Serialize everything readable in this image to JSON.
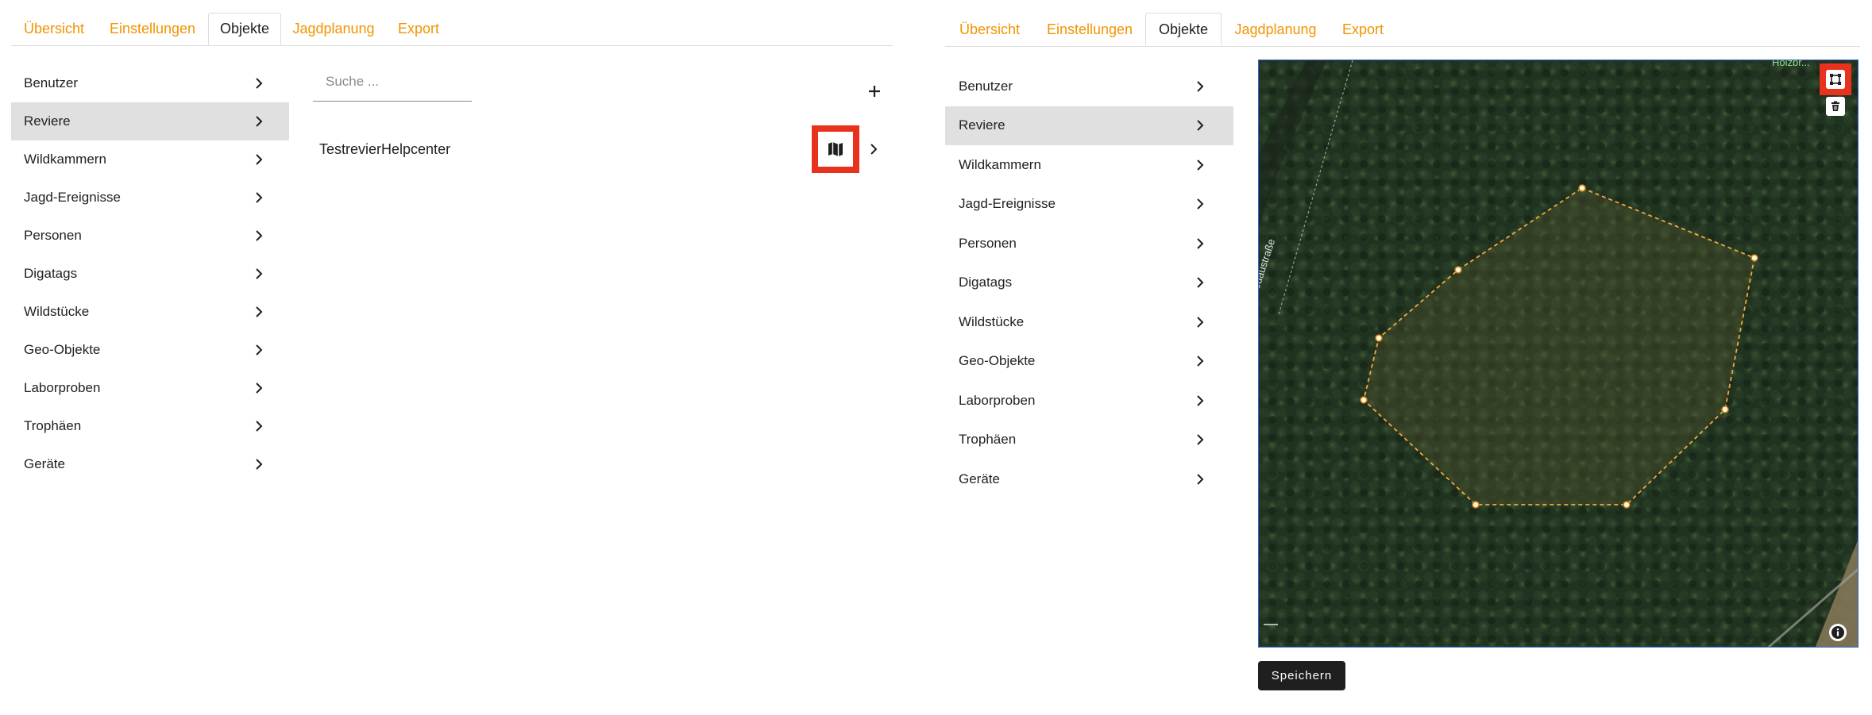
{
  "left": {
    "tabs": [
      {
        "label": "Übersicht"
      },
      {
        "label": "Einstellungen"
      },
      {
        "label": "Objekte",
        "active": true
      },
      {
        "label": "Jagdplanung"
      },
      {
        "label": "Export"
      }
    ],
    "menu": [
      {
        "label": "Benutzer"
      },
      {
        "label": "Reviere",
        "selected": true
      },
      {
        "label": "Wildkammern"
      },
      {
        "label": "Jagd-Ereignisse"
      },
      {
        "label": "Personen"
      },
      {
        "label": "Digatags"
      },
      {
        "label": "Wildstücke"
      },
      {
        "label": "Geo-Objekte"
      },
      {
        "label": "Laborproben"
      },
      {
        "label": "Trophäen"
      },
      {
        "label": "Geräte"
      }
    ],
    "search": {
      "placeholder": "Suche ..."
    },
    "add_icon": "plus-icon",
    "list": [
      {
        "label": "TestrevierHelpcenter",
        "action_icon": "map-icon",
        "highlighted": true
      }
    ]
  },
  "right": {
    "tabs": [
      {
        "label": "Übersicht"
      },
      {
        "label": "Einstellungen"
      },
      {
        "label": "Objekte",
        "active": true
      },
      {
        "label": "Jagdplanung"
      },
      {
        "label": "Export"
      }
    ],
    "menu": [
      {
        "label": "Benutzer"
      },
      {
        "label": "Reviere",
        "selected": true
      },
      {
        "label": "Wildkammern"
      },
      {
        "label": "Jagd-Ereignisse"
      },
      {
        "label": "Personen"
      },
      {
        "label": "Digatags"
      },
      {
        "label": "Wildstücke"
      },
      {
        "label": "Geo-Objekte"
      },
      {
        "label": "Laborproben"
      },
      {
        "label": "Trophäen"
      },
      {
        "label": "Geräte"
      }
    ],
    "map": {
      "street_label": "Wiedaustraße",
      "top_label": "Holzbr...",
      "controls": [
        "polygon-draw-icon",
        "trash-icon",
        "info-icon"
      ],
      "polygon_color": "#f2a93b"
    },
    "save_label": "Speichern"
  },
  "colors": {
    "accent": "#f29400",
    "highlight": "#e8321e",
    "selected_bg": "#e0e0e0",
    "button_bg": "#1f1f1f"
  }
}
